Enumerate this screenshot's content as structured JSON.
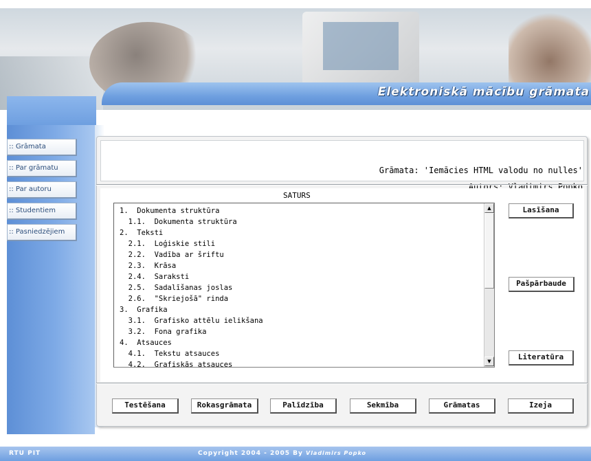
{
  "header": {
    "title": "Elektroniskā mācību grāmata"
  },
  "sidebar": {
    "items": [
      {
        "label": ":: Grāmata"
      },
      {
        "label": ":: Par grāmatu"
      },
      {
        "label": ":: Par autoru"
      },
      {
        "label": ":: Studentiem"
      },
      {
        "label": ":: Pasniedzējiem"
      }
    ]
  },
  "book": {
    "title_line": "Grāmata: 'Iemācies HTML valodu no nulles'",
    "author_line": "Autors: Vladimirs Popko"
  },
  "toc": {
    "heading": "SATURS",
    "items": [
      "1.  Dokumenta struktūra",
      "  1.1.  Dokumenta struktūra",
      "2.  Teksti",
      "  2.1.  Loģiskie stili",
      "  2.2.  Vadība ar šriftu",
      "  2.3.  Krāsa",
      "  2.4.  Saraksti",
      "  2.5.  Sadalīšanas joslas",
      "  2.6.  \"Skriejošā\" rinda",
      "3.  Grafika",
      "  3.1.  Grafisko attēlu ielikšana",
      "  3.2.  Fona grafika",
      "4.  Atsauces",
      "  4.1.  Tekstu atsauces",
      "  4.2.  Grafiskās atsauces"
    ]
  },
  "side_buttons": {
    "reading": "Lasīšana",
    "self_check": "Pašpārbaude",
    "literature": "Literatūra"
  },
  "bottom_buttons": {
    "testing": "Testēšana",
    "handbook": "Rokasgrāmata",
    "help": "Palīdzība",
    "progress": "Sekmība",
    "books": "Grāmatas",
    "exit": "Izeja"
  },
  "footer": {
    "left": "RTU PIT",
    "copyright": "Copyright 2004 - 2005  By ",
    "author": "Vladimirs Popko"
  },
  "scroll": {
    "up_glyph": "▲",
    "down_glyph": "▼"
  }
}
